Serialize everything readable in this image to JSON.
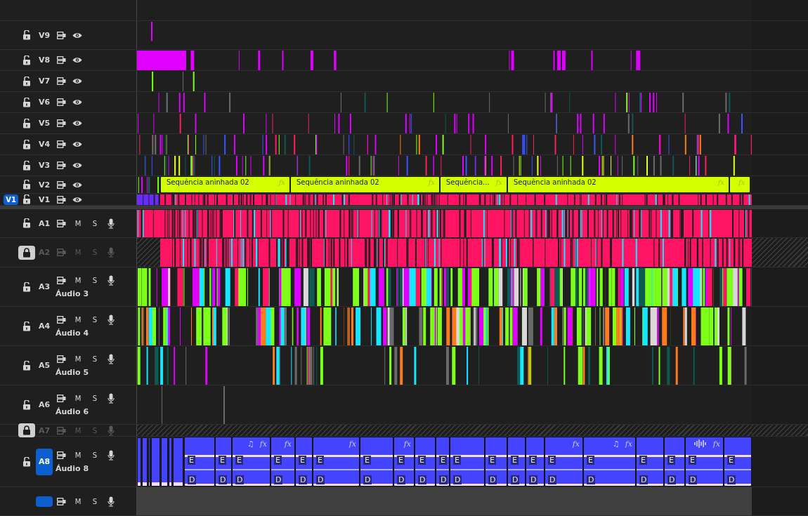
{
  "video_tracks": [
    {
      "name": "V9",
      "locked": false
    },
    {
      "name": "V8",
      "locked": false
    },
    {
      "name": "V7",
      "locked": false
    },
    {
      "name": "V6",
      "locked": false
    },
    {
      "name": "V5",
      "locked": false
    },
    {
      "name": "V4",
      "locked": false
    },
    {
      "name": "V3",
      "locked": false
    },
    {
      "name": "V2",
      "locked": false,
      "clips": [
        {
          "title": "Sequência aninhada 02",
          "effect": "fx"
        },
        {
          "title": "Sequência aninhada 02",
          "effect": "fx"
        },
        {
          "title": "Sequência...",
          "effect": "fx"
        },
        {
          "title": "Sequência aninhada 02",
          "effect": "fx"
        },
        {
          "effect": "fx"
        }
      ]
    },
    {
      "name": "V1",
      "locked": false,
      "source_patch": "V1"
    }
  ],
  "audio_tracks": [
    {
      "name": "A1",
      "locked": false,
      "mute": "M",
      "solo": "S",
      "targeted": false
    },
    {
      "name": "A2",
      "locked": true,
      "mute": "M",
      "solo": "S",
      "targeted": false
    },
    {
      "name": "A3",
      "title": "Áudio 3",
      "locked": false,
      "mute": "M",
      "solo": "S",
      "targeted": false
    },
    {
      "name": "A4",
      "title": "Áudio 4",
      "locked": false,
      "mute": "M",
      "solo": "S",
      "targeted": false
    },
    {
      "name": "A5",
      "title": "Áudio 5",
      "locked": false,
      "mute": "M",
      "solo": "S",
      "targeted": false
    },
    {
      "name": "A6",
      "title": "Áudio 6",
      "locked": false,
      "mute": "M",
      "solo": "S",
      "targeted": false
    },
    {
      "name": "A7",
      "locked": true,
      "mute": "M",
      "solo": "S",
      "targeted": false
    },
    {
      "name": "A8",
      "title": "Áudio 8",
      "locked": false,
      "mute": "M",
      "solo": "S",
      "targeted": true,
      "clips": [
        {
          "labels": [
            "E",
            "D"
          ]
        },
        {
          "labels": [
            "E",
            "D"
          ]
        },
        {
          "labels": [
            "E",
            "D"
          ],
          "marks": [
            {
              "kind": "text",
              "text": "♫"
            },
            {
              "kind": "text",
              "text": "fx"
            }
          ]
        },
        {
          "labels": [
            "E",
            "D"
          ],
          "marks": [
            {
              "kind": "text",
              "text": "fx"
            }
          ]
        },
        {
          "labels": [
            "E",
            "D"
          ]
        },
        {
          "labels": [
            "E",
            "D"
          ],
          "marks": [
            {
              "kind": "text",
              "text": "fx"
            }
          ]
        },
        {
          "labels": [
            "E",
            "D"
          ]
        },
        {
          "labels": [
            "E",
            "D"
          ],
          "marks": [
            {
              "kind": "text",
              "text": "fx"
            }
          ]
        },
        {
          "labels": [
            "E",
            "D"
          ]
        },
        {
          "labels": [
            "E",
            "D"
          ]
        },
        {
          "labels": [
            "E",
            "D"
          ]
        },
        {
          "labels": [
            "E",
            "D"
          ]
        },
        {
          "labels": [
            "E",
            "D"
          ]
        },
        {
          "labels": [
            "E",
            "D"
          ]
        },
        {
          "labels": [
            "E",
            "D"
          ],
          "marks": [
            {
              "kind": "text",
              "text": "fx"
            }
          ]
        },
        {
          "labels": [
            "E",
            "D"
          ],
          "marks": [
            {
              "kind": "text",
              "text": "♫"
            },
            {
              "kind": "text",
              "text": "fx"
            }
          ]
        },
        {
          "labels": [
            "E",
            "D"
          ]
        },
        {
          "labels": [
            "E",
            "D"
          ]
        },
        {
          "labels": [
            "E",
            "D"
          ],
          "marks": [
            {
              "kind": "waveform"
            },
            {
              "kind": "text",
              "text": "fx"
            }
          ]
        },
        {
          "labels": [
            "E",
            "D"
          ]
        }
      ]
    },
    {
      "mute": "M",
      "solo": "S",
      "targeted": true
    }
  ]
}
